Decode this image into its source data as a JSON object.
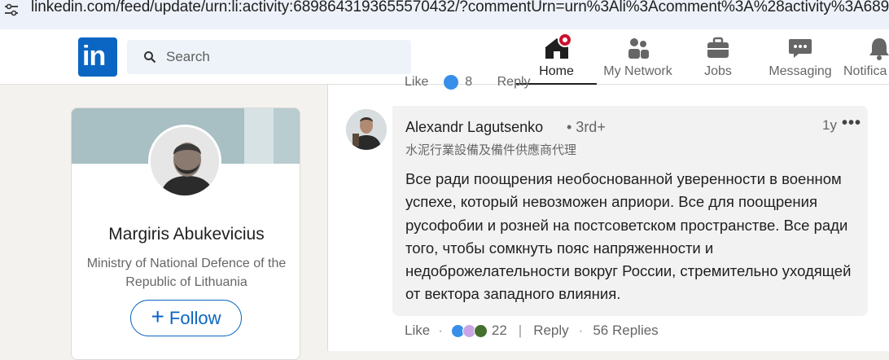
{
  "browser": {
    "url": "linkedin.com/feed/update/urn:li:activity:6898643193655570432/?commentUrn=urn%3Ali%3Acomment%3A%28activity%3A68986431936"
  },
  "nav": {
    "search_placeholder": "Search",
    "items": [
      {
        "label": "Home",
        "icon": "home-icon",
        "active": true
      },
      {
        "label": "My Network",
        "icon": "people-icon"
      },
      {
        "label": "Jobs",
        "icon": "briefcase-icon"
      },
      {
        "label": "Messaging",
        "icon": "chat-icon"
      },
      {
        "label": "Notifica",
        "icon": "bell-icon"
      }
    ]
  },
  "profile": {
    "name": "Margiris Abukevicius",
    "headline": "Ministry of National Defence of the Republic of Lithuania",
    "follow_label": "Follow"
  },
  "previous_comment": {
    "like_label": "Like",
    "reaction_count": "8",
    "reply_label": "Reply"
  },
  "comment": {
    "author": "Alexandr Lagutsenko",
    "degree": "• 3rd+",
    "subtitle": "水泥行業設備及備件供應商代理",
    "time": "1y",
    "more": "•••",
    "text": "Все ради поощрения необоснованной уверенности в военном успехе, который невозможен априори. Все для поощрения русофобии и розней на постсоветском пространстве. Все ради того, чтобы сомкнуть пояс напряженности и недоброжелательности вокруг России, стремительно уходящей от вектора западного влияния.",
    "like_label": "Like",
    "reaction_count": "22",
    "reply_label": "Reply",
    "replies": "56 Replies"
  },
  "colors": {
    "brand": "#0a66c2",
    "notification": "#cb112d"
  }
}
